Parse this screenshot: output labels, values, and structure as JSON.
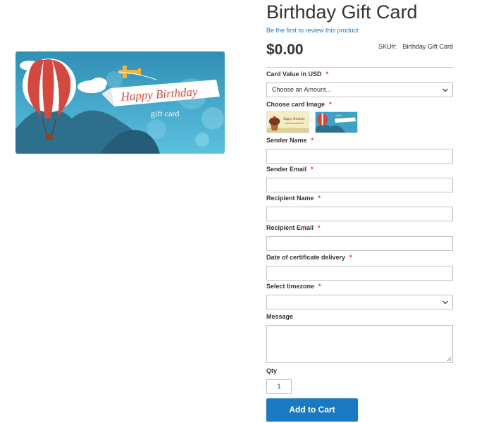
{
  "product": {
    "title": "Birthday Gift Card",
    "review_link": "Be the first to review this product",
    "price": "$0.00",
    "sku_label": "SKU#:",
    "sku_value": "Birthday Gift Card"
  },
  "main_image": {
    "banner_text": "Happy Birthday",
    "sub_text": "gift card"
  },
  "form": {
    "card_value": {
      "label": "Card Value in USD",
      "selected": "Choose an Amount..."
    },
    "card_image": {
      "label": "Choose card Image",
      "thumb1_text": "Happy Birthday"
    },
    "sender_name": {
      "label": "Sender Name",
      "value": ""
    },
    "sender_email": {
      "label": "Sender Email",
      "value": ""
    },
    "recipient_name": {
      "label": "Recipient Name",
      "value": ""
    },
    "recipient_email": {
      "label": "Recipient Email",
      "value": ""
    },
    "delivery_date": {
      "label": "Date of certificate delivery",
      "value": ""
    },
    "timezone": {
      "label": "Select timezone",
      "selected": ""
    },
    "message": {
      "label": "Message",
      "value": ""
    },
    "qty": {
      "label": "Qty",
      "value": "1"
    },
    "required_mark": "*",
    "add_to_cart": "Add to Cart"
  },
  "colors": {
    "accent": "#1979c3",
    "required": "#e02b27",
    "text": "#333333",
    "border": "#c2c2c2"
  }
}
